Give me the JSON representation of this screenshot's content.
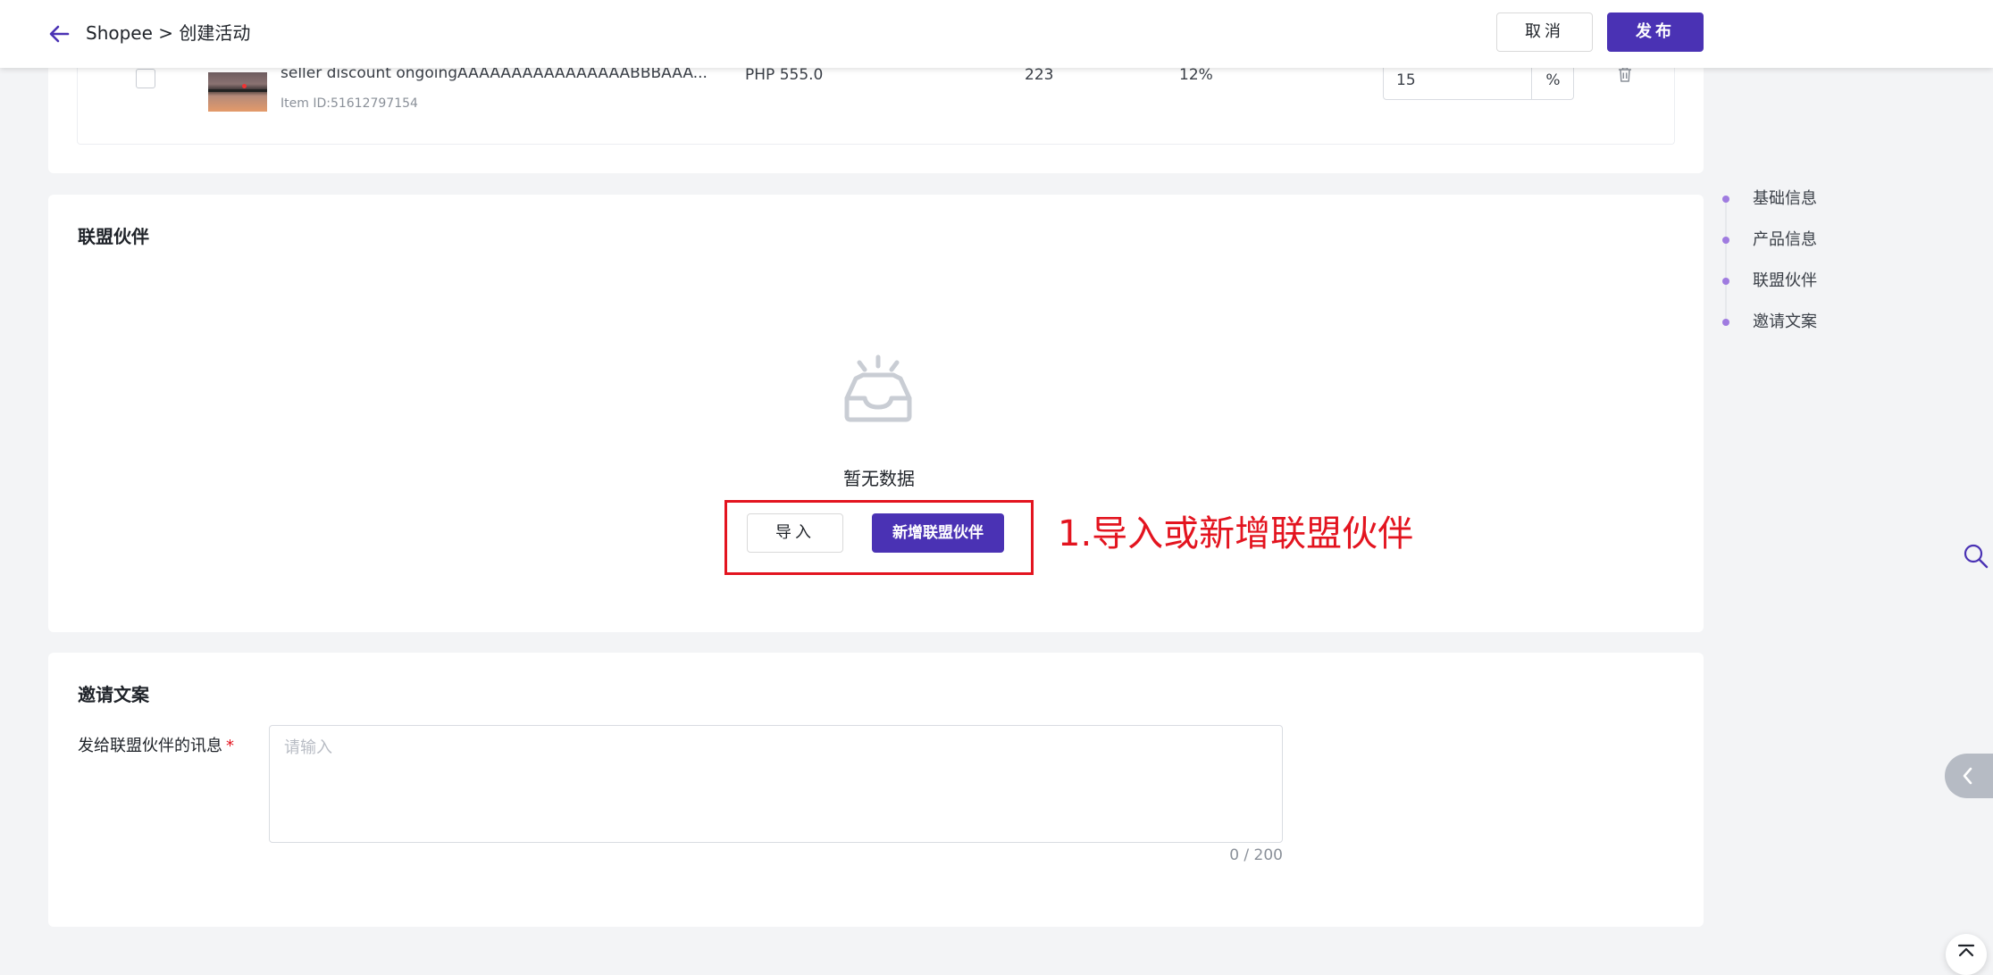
{
  "header": {
    "breadcrumb": "Shopee > 创建活动",
    "cancel_label": "取消",
    "publish_label": "发布"
  },
  "product_row": {
    "name": "seller discount ongoingAAAAAAAAAAAAAAAABBBAAA...",
    "item_id": "Item ID:51612797154",
    "price": "PHP 555.0",
    "sales": "223",
    "rate": "12%",
    "commission_value": "15",
    "commission_unit": "%"
  },
  "partners": {
    "title": "联盟伙伴",
    "empty_text": "暂无数据",
    "import_label": "导入",
    "add_label": "新增联盟伙伴",
    "annotation": "1.导入或新增联盟伙伴"
  },
  "invite": {
    "title": "邀请文案",
    "field_label": "发给联盟伙伴的讯息",
    "required_mark": "*",
    "placeholder": "请输入",
    "char_count": "0 / 200"
  },
  "side_nav": {
    "items": [
      "基础信息",
      "产品信息",
      "联盟伙伴",
      "邀请文案"
    ]
  },
  "colors": {
    "brand": "#4a32b4",
    "annotation_red": "#e3141f",
    "nav_dot": "#9f7be0"
  }
}
